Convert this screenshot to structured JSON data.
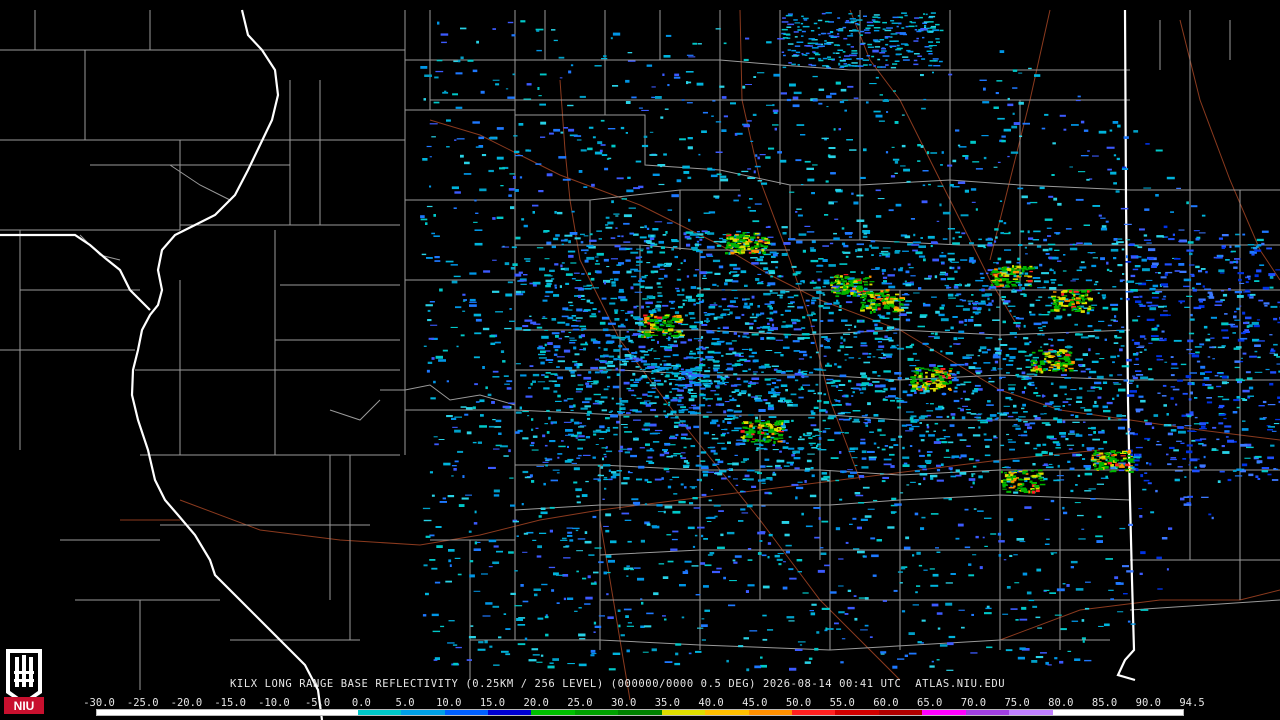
{
  "caption": "KILX LONG RANGE BASE REFLECTIVITY (0.25KM / 256 LEVEL) (000000/0000 0.5 DEG) 2026-08-14 00:41 UTC  ATLAS.NIU.EDU",
  "scale": {
    "labels": [
      "-30.0",
      "-25.0",
      "-20.0",
      "-15.0",
      "-10.0",
      "-5.0",
      "0.0",
      "5.0",
      "10.0",
      "15.0",
      "20.0",
      "25.0",
      "30.0",
      "35.0",
      "40.0",
      "45.0",
      "50.0",
      "55.0",
      "60.0",
      "65.0",
      "70.0",
      "75.0",
      "80.0",
      "85.0",
      "90.0",
      "94.5"
    ],
    "colors": [
      "#ffffff",
      "#ffffff",
      "#ffffff",
      "#ffffff",
      "#ffffff",
      "#ffffff",
      "#00c8c8",
      "#00a0e6",
      "#0060ff",
      "#0000d0",
      "#00c000",
      "#00a000",
      "#008000",
      "#dede00",
      "#ffc000",
      "#ff9000",
      "#ff2020",
      "#d00000",
      "#b00000",
      "#ff00ff",
      "#a040e0",
      "#c080ff",
      "#ffffff",
      "#ffffff",
      "#ffffff"
    ]
  },
  "logo": {
    "text": "NIU"
  },
  "colors": {
    "background": "#000000",
    "county_lines": "#9a9a9a",
    "state_lines": "#ffffff",
    "roads": "#8b3a1e"
  }
}
